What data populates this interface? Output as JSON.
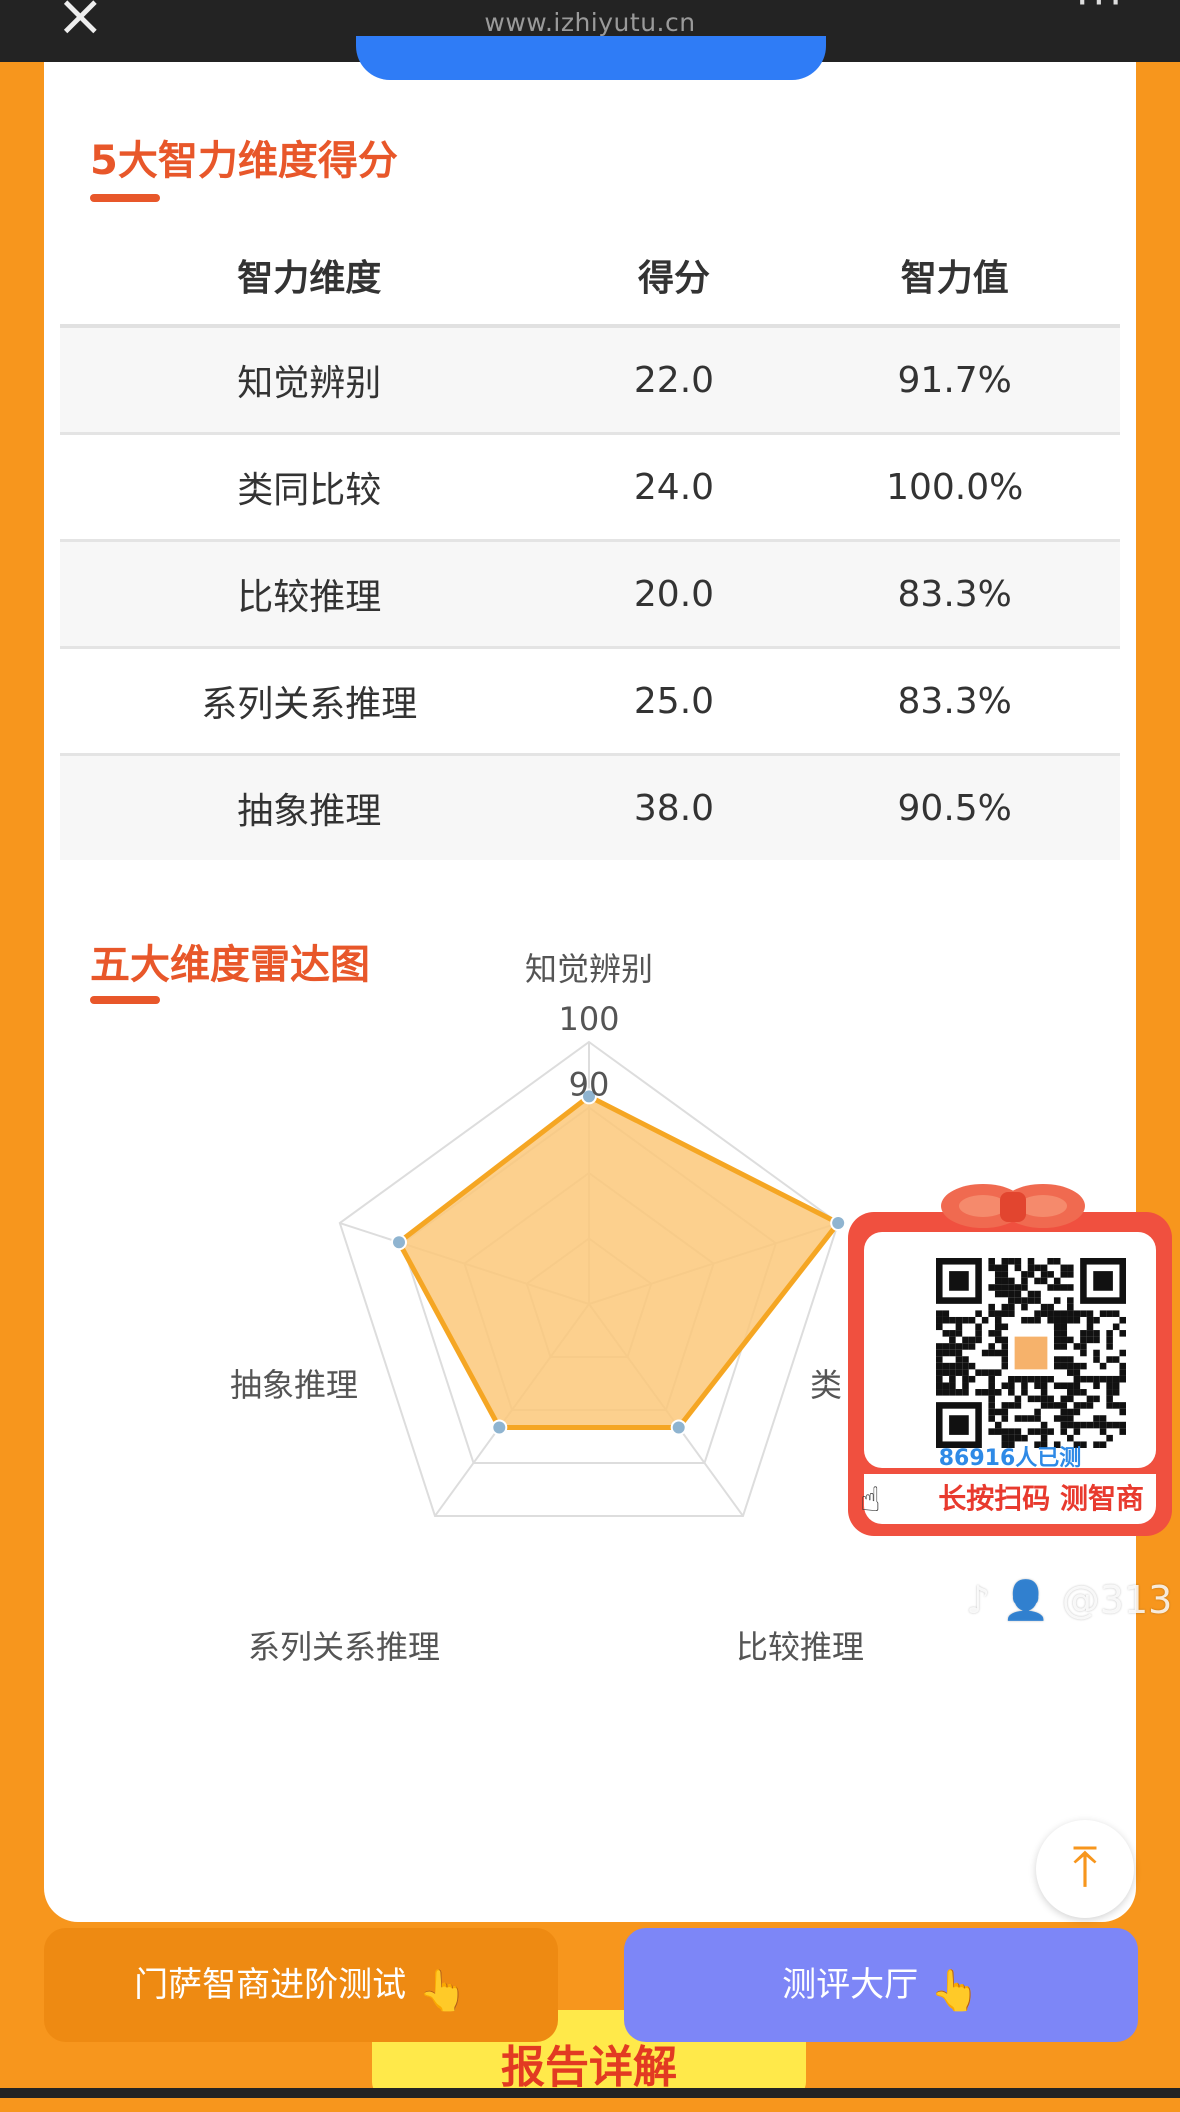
{
  "browser": {
    "url": "www.izhiyutu.cn",
    "close_icon": "close-icon",
    "more_icon": "more-icon"
  },
  "section1": {
    "title": "5大智力维度得分"
  },
  "table": {
    "headers": [
      "智力维度",
      "得分",
      "智力值"
    ],
    "rows": [
      [
        "知觉辨别",
        "22.0",
        "91.7%"
      ],
      [
        "类同比较",
        "24.0",
        "100.0%"
      ],
      [
        "比较推理",
        "20.0",
        "83.3%"
      ],
      [
        "系列关系推理",
        "25.0",
        "83.3%"
      ],
      [
        "抽象推理",
        "38.0",
        "90.5%"
      ]
    ]
  },
  "section2": {
    "title": "五大维度雷达图"
  },
  "chart_data": {
    "type": "radar",
    "axes": [
      "知觉辨别",
      "类同比较",
      "比较推理",
      "系列关系推理",
      "抽象推理"
    ],
    "values": [
      91.7,
      100.0,
      83.3,
      83.3,
      90.5
    ],
    "scale_labels": [
      "100",
      "90"
    ],
    "range": [
      60,
      100
    ],
    "series_color": "#f5a623",
    "fill_color": "#fcc87a",
    "truncated_axis_label": "类"
  },
  "promo": {
    "count_text": "86916人已测",
    "scan_text": "长按扫码 测智商",
    "hand_icon": "pointing-hand-icon"
  },
  "watermark": {
    "text": "@313"
  },
  "buttons": {
    "left": "门萨智商进阶测试",
    "right": "测评大厅"
  },
  "yellow_tab": {
    "text": "报告详解"
  },
  "colors": {
    "page_bg": "#f7961d",
    "accent": "#e8572a",
    "button_left": "#ee8a12",
    "button_right": "#7d86f7"
  }
}
